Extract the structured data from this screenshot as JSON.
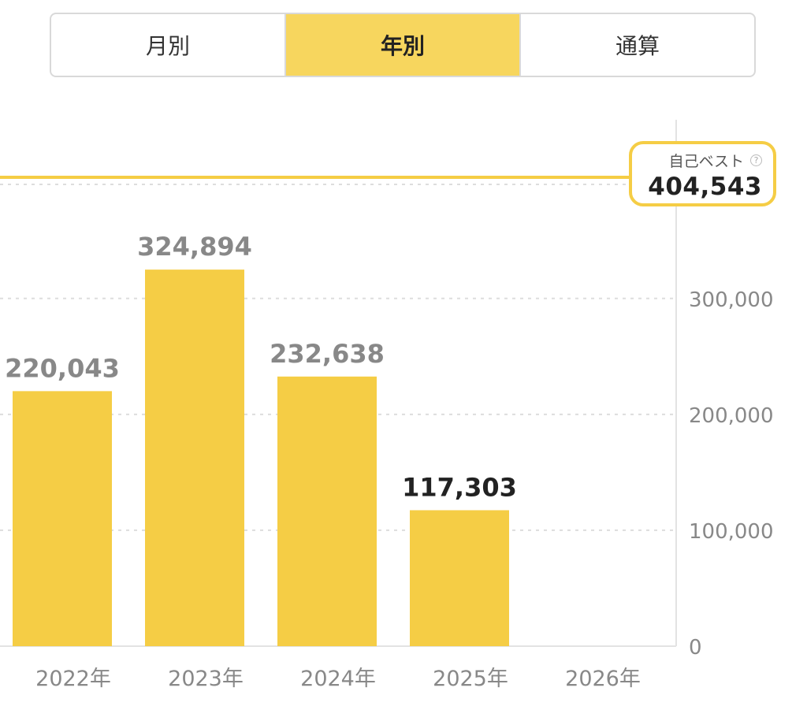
{
  "tabs": [
    {
      "label": "月別",
      "active": false
    },
    {
      "label": "年別",
      "active": true
    },
    {
      "label": "通算",
      "active": false
    }
  ],
  "colors": {
    "accent": "#f5cd45",
    "tab_active_bg": "#f7d65e",
    "value_label": "#888888",
    "value_label_current": "#222222",
    "axis_text": "#888888",
    "grid": "#dddddd"
  },
  "best": {
    "label": "自己ベスト",
    "value_text": "404,543",
    "value": 404543,
    "help_icon": "question-circle-icon",
    "help_glyph": "?"
  },
  "chart_data": {
    "type": "bar",
    "title": "",
    "xlabel": "",
    "ylabel": "",
    "categories": [
      "2022年",
      "2023年",
      "2024年",
      "2025年",
      "2026年"
    ],
    "values": [
      220043,
      324894,
      232638,
      117303,
      null
    ],
    "value_labels": [
      "220,043",
      "324,894",
      "232,638",
      "117,303",
      ""
    ],
    "current_index": 3,
    "yticks": [
      0,
      100000,
      200000,
      300000
    ],
    "ytick_labels": [
      "0",
      "100,000",
      "200,000",
      "300,000"
    ],
    "ylim": [
      0,
      404543
    ],
    "reference_line": {
      "value": 404543,
      "label": "自己ベスト"
    },
    "grid": true,
    "legend": "none"
  }
}
